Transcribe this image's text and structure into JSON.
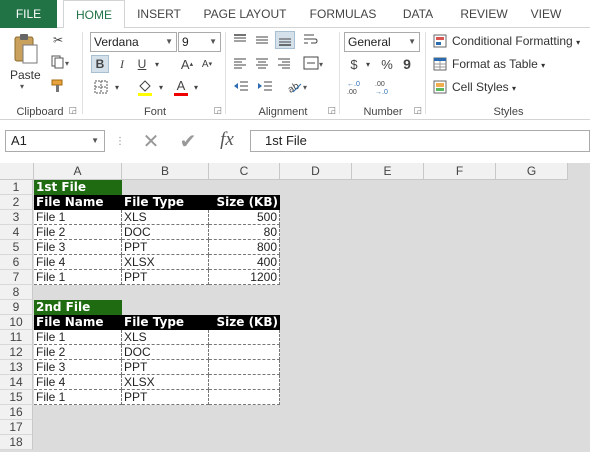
{
  "tabs": {
    "file": "FILE",
    "home": "HOME",
    "insert": "INSERT",
    "page_layout": "PAGE LAYOUT",
    "formulas": "FORMULAS",
    "data": "DATA",
    "review": "REVIEW",
    "view": "VIEW"
  },
  "ribbon": {
    "clipboard": {
      "paste": "Paste",
      "label": "Clipboard"
    },
    "font": {
      "name": "Verdana",
      "size": "9",
      "bold": "B",
      "italic": "I",
      "underline": "U",
      "grow": "A",
      "shrink": "A",
      "color_a": "A",
      "label": "Font"
    },
    "alignment": {
      "label": "Alignment"
    },
    "number": {
      "format": "General",
      "currency": "$",
      "percent": "%",
      "comma": "9",
      "label": "Number"
    },
    "styles": {
      "conditional": "Conditional Formatting",
      "table": "Format as Table",
      "cell_styles": "Cell Styles",
      "label": "Styles"
    }
  },
  "formula_bar": {
    "name_box": "A1",
    "fx": "fx",
    "content": "1st File"
  },
  "columns": [
    "A",
    "B",
    "C",
    "D",
    "E",
    "F",
    "G"
  ],
  "rows": [
    "1",
    "2",
    "3",
    "4",
    "5",
    "6",
    "7",
    "8",
    "9",
    "10",
    "11",
    "12",
    "13",
    "14",
    "15",
    "16",
    "17",
    "18"
  ],
  "table1": {
    "title": "1st File",
    "headers": [
      "File Name",
      "File Type",
      "Size (KB)"
    ],
    "rows": [
      [
        "File 1",
        "XLS",
        "500"
      ],
      [
        "File 2",
        "DOC",
        "80"
      ],
      [
        "File 3",
        "PPT",
        "800"
      ],
      [
        "File 4",
        "XLSX",
        "400"
      ],
      [
        "File 1",
        "PPT",
        "1200"
      ]
    ]
  },
  "table2": {
    "title": "2nd File",
    "headers": [
      "File Name",
      "File Type",
      "Size (KB)"
    ],
    "rows": [
      [
        "File 1",
        "XLS",
        ""
      ],
      [
        "File 2",
        "DOC",
        ""
      ],
      [
        "File 3",
        "PPT",
        ""
      ],
      [
        "File 4",
        "XLSX",
        ""
      ],
      [
        "File 1",
        "PPT",
        ""
      ]
    ]
  },
  "colors": {
    "file_tab": "#217346",
    "title_fill": "#1e6b12",
    "header_fill": "#000000"
  }
}
